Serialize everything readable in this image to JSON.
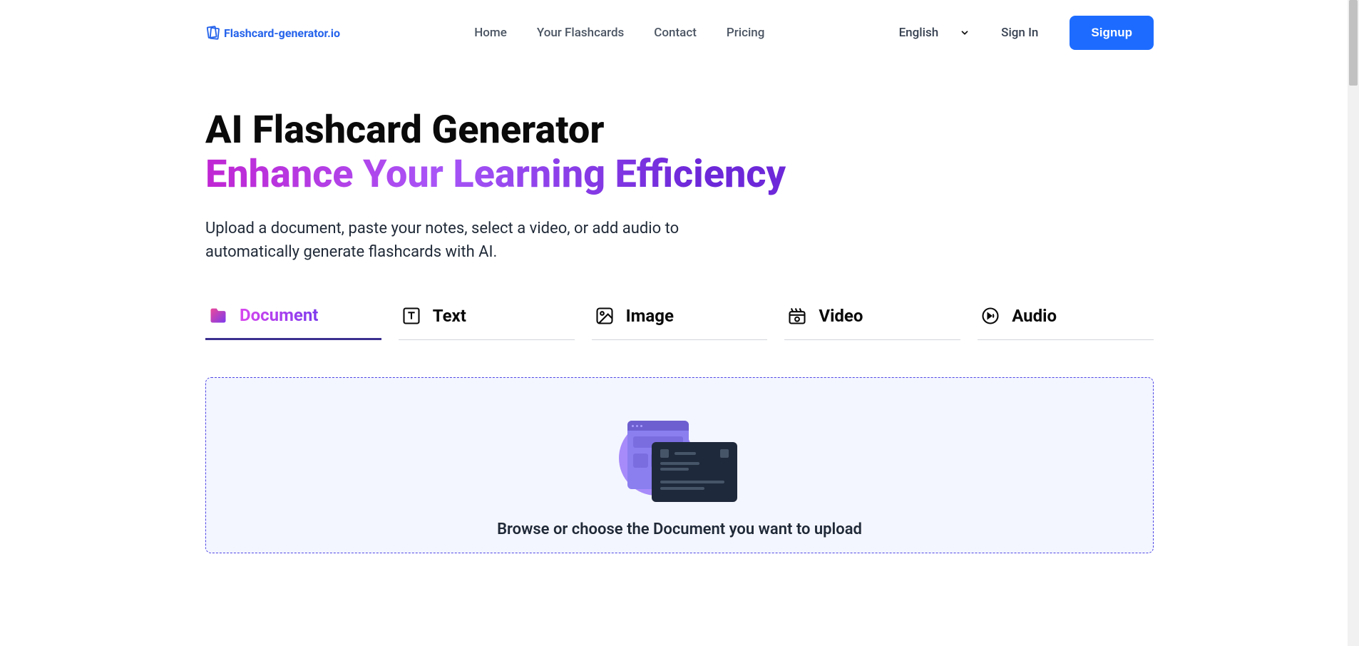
{
  "header": {
    "logo_text": "Flashcard-generator.io",
    "nav": {
      "home": "Home",
      "flashcards": "Your Flashcards",
      "contact": "Contact",
      "pricing": "Pricing"
    },
    "language": "English",
    "signin": "Sign In",
    "signup": "Signup"
  },
  "hero": {
    "title_line1": "AI Flashcard Generator",
    "title_line2": "Enhance Your Learning Efficiency",
    "subtitle": "Upload a document, paste your notes, select a video, or add audio to automatically generate flashcards with AI."
  },
  "tabs": {
    "document": "Document",
    "text": "Text",
    "image": "Image",
    "video": "Video",
    "audio": "Audio"
  },
  "upload": {
    "prompt": "Browse or choose the Document you want to upload"
  }
}
